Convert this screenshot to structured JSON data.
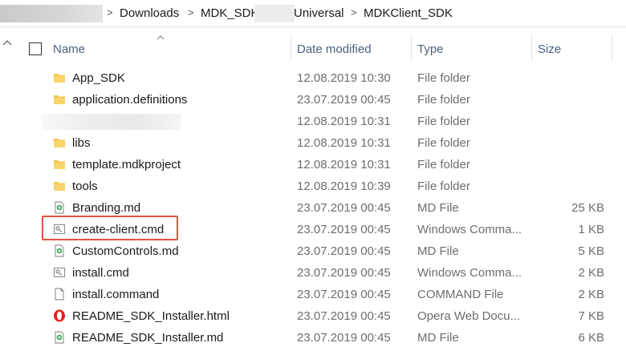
{
  "breadcrumb": {
    "items": [
      "Downloads",
      "MDK_SDK",
      "Universal",
      "MDKClient_SDK"
    ],
    "separator": ">"
  },
  "columns": {
    "name": "Name",
    "date": "Date modified",
    "type": "Type",
    "size": "Size"
  },
  "files": [
    {
      "name": "App_SDK",
      "date": "12.08.2019 10:30",
      "type": "File folder",
      "size": "",
      "icon": "folder-icon"
    },
    {
      "name": "application.definitions",
      "date": "23.07.2019 00:45",
      "type": "File folder",
      "size": "",
      "icon": "folder-icon"
    },
    {
      "name": "",
      "date": "12.08.2019 10:31",
      "type": "File folder",
      "size": "",
      "icon": "blurred"
    },
    {
      "name": "libs",
      "date": "12.08.2019 10:31",
      "type": "File folder",
      "size": "",
      "icon": "folder-icon"
    },
    {
      "name": "template.mdkproject",
      "date": "12.08.2019 10:31",
      "type": "File folder",
      "size": "",
      "icon": "folder-icon"
    },
    {
      "name": "tools",
      "date": "12.08.2019 10:39",
      "type": "File folder",
      "size": "",
      "icon": "folder-icon"
    },
    {
      "name": "Branding.md",
      "date": "23.07.2019 00:45",
      "type": "MD File",
      "size": "25 KB",
      "icon": "md-file-icon"
    },
    {
      "name": "create-client.cmd",
      "date": "23.07.2019 00:45",
      "type": "Windows Comma...",
      "size": "1 KB",
      "icon": "cmd-file-icon"
    },
    {
      "name": "CustomControls.md",
      "date": "23.07.2019 00:45",
      "type": "MD File",
      "size": "5 KB",
      "icon": "md-file-icon"
    },
    {
      "name": "install.cmd",
      "date": "23.07.2019 00:45",
      "type": "Windows Comma...",
      "size": "2 KB",
      "icon": "cmd-file-icon"
    },
    {
      "name": "install.command",
      "date": "23.07.2019 00:45",
      "type": "COMMAND File",
      "size": "2 KB",
      "icon": "blank-file-icon"
    },
    {
      "name": "README_SDK_Installer.html",
      "date": "23.07.2019 00:45",
      "type": "Opera Web Docu...",
      "size": "7 KB",
      "icon": "opera-icon"
    },
    {
      "name": "README_SDK_Installer.md",
      "date": "23.07.2019 00:45",
      "type": "MD File",
      "size": "6 KB",
      "icon": "md-file-icon"
    }
  ],
  "colors": {
    "header_text": "#4c607a",
    "secondary_text": "#6d6d6d",
    "folder": "#f6c342",
    "highlight": "#e0533f",
    "opera": "#e0201b"
  }
}
